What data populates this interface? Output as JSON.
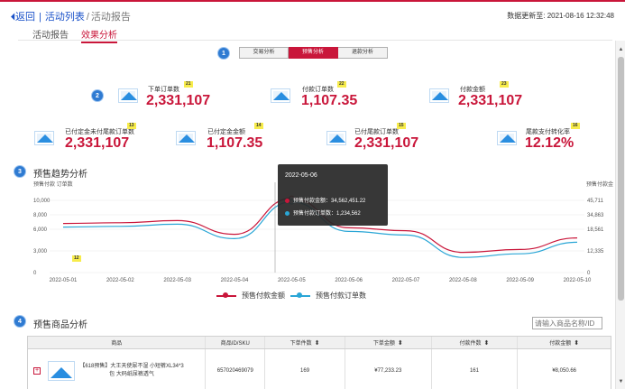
{
  "header": {
    "back_icon": "⏴",
    "back": "返回",
    "activity_list": "活动列表",
    "current": "活动报告",
    "separator1": "|",
    "separator2": "/",
    "updated": "数据更新至: 2021-08-16 12:32:48"
  },
  "tabs": [
    {
      "label": "活动报告",
      "active": false
    },
    {
      "label": "效果分析",
      "active": true
    }
  ],
  "badges": {
    "b1": "1",
    "b2": "2",
    "b3": "3",
    "b4": "4"
  },
  "segmented": {
    "options": [
      "交易分析",
      "预售分析",
      "退款分析"
    ],
    "active_index": 1
  },
  "kpis": {
    "k21": {
      "tag": "21",
      "label": "下单订单数",
      "value": "2,331,107"
    },
    "k22": {
      "tag": "22",
      "label": "付款订单数",
      "value": "1,107.35"
    },
    "k23": {
      "tag": "23",
      "label": "付款金额",
      "value": "2,331,107"
    },
    "k13": {
      "tag": "13",
      "label": "已付定金未付尾款订单数",
      "value": "2,331,107"
    },
    "k14": {
      "tag": "14",
      "label": "已付定金金额",
      "value": "1,107.35"
    },
    "k15": {
      "tag": "15",
      "label": "已付尾款订单数",
      "value": "2,331,107"
    },
    "k16": {
      "tag": "16",
      "label": "尾款支付转化率",
      "value": "12.12%"
    }
  },
  "presale_trend": {
    "title": "预售趋势分析",
    "y_left_title": "预售付款 订单数",
    "y_right_title": "预售付款金额",
    "y_left_ticks": [
      "10,000",
      "8,000",
      "6,000",
      "3,000",
      "0"
    ],
    "y_right_ticks": [
      "45,711",
      "34,863",
      "18,561",
      "12,335",
      "0"
    ],
    "tag_12": "12"
  },
  "chart_data": {
    "type": "line",
    "x": [
      "2022-05-01",
      "2022-05-02",
      "2022-05-03",
      "2022-05-04",
      "2022-05-05",
      "2022-05-06",
      "2022-05-07",
      "2022-05-08",
      "2022-05-09",
      "2022-05-10"
    ],
    "series": [
      {
        "name": "预售付款金额",
        "color": "#c9163a",
        "values": [
          6800,
          6900,
          7200,
          5300,
          10300,
          6200,
          5800,
          2800,
          3200,
          4800
        ]
      },
      {
        "name": "预售付款订单数",
        "color": "#2aa6d6",
        "values": [
          6300,
          6400,
          6700,
          4700,
          9800,
          5700,
          5200,
          2100,
          2600,
          4200
        ]
      }
    ],
    "ylim": [
      0,
      10000
    ],
    "legend": "bottom-center"
  },
  "tooltip": {
    "date": "2022-05-06",
    "row1": "预售付款金额：34,562,451.22",
    "row2": "预售付款订单数：1,234,562"
  },
  "products": {
    "title": "预售商品分析",
    "search_placeholder": "请输入商品名称/ID",
    "columns": [
      "商品",
      "商品ID/SKU",
      "下单件数",
      "下单金额",
      "付款件数",
      "付款金额"
    ],
    "rows": [
      {
        "name": "【618预售】大王天使尿不湿 小短裤XL34*3包 大码纸尿裤透气",
        "id": "657020469079",
        "order_qty": "169",
        "order_amount": "¥77,233.23",
        "paid_qty": "161",
        "paid_amount": "¥8,050.66"
      }
    ]
  },
  "icons": {
    "plus": "+",
    "sort": "⬍",
    "scroll_up": "▲",
    "scroll_down": "▼"
  }
}
